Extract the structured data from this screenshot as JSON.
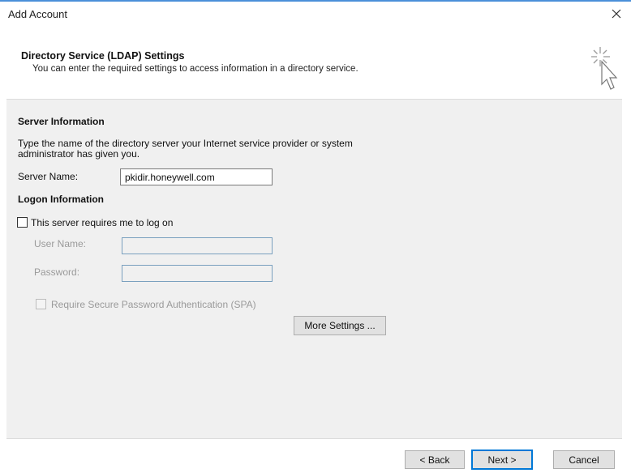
{
  "window": {
    "title": "Add Account",
    "close_glyph": "✕"
  },
  "header": {
    "title": "Directory Service (LDAP) Settings",
    "subtitle": "You can enter the required settings to access information in a directory service.",
    "icon": "wizard-cursor-icon"
  },
  "server_info": {
    "title": "Server Information",
    "description_line1": "Type the name of the directory server your Internet service provider or system",
    "description_line2": "administrator has given you.",
    "server_name_label": "Server Name:",
    "server_name_value": "pkidir.honeywell.com"
  },
  "logon_info": {
    "title": "Logon Information",
    "requires_logon_label": "This server requires me to log on",
    "requires_logon_checked": false,
    "user_name_label": "User Name:",
    "user_name_value": "",
    "password_label": "Password:",
    "password_value": "",
    "spa_label": "Require Secure Password Authentication (SPA)",
    "spa_checked": false
  },
  "buttons": {
    "more_settings": "More Settings ...",
    "back": "< Back",
    "next": "Next >",
    "cancel": "Cancel"
  },
  "colors": {
    "accent": "#0078d7",
    "panel_bg": "#f0f0f0",
    "disabled_text": "#9a9a9a"
  }
}
